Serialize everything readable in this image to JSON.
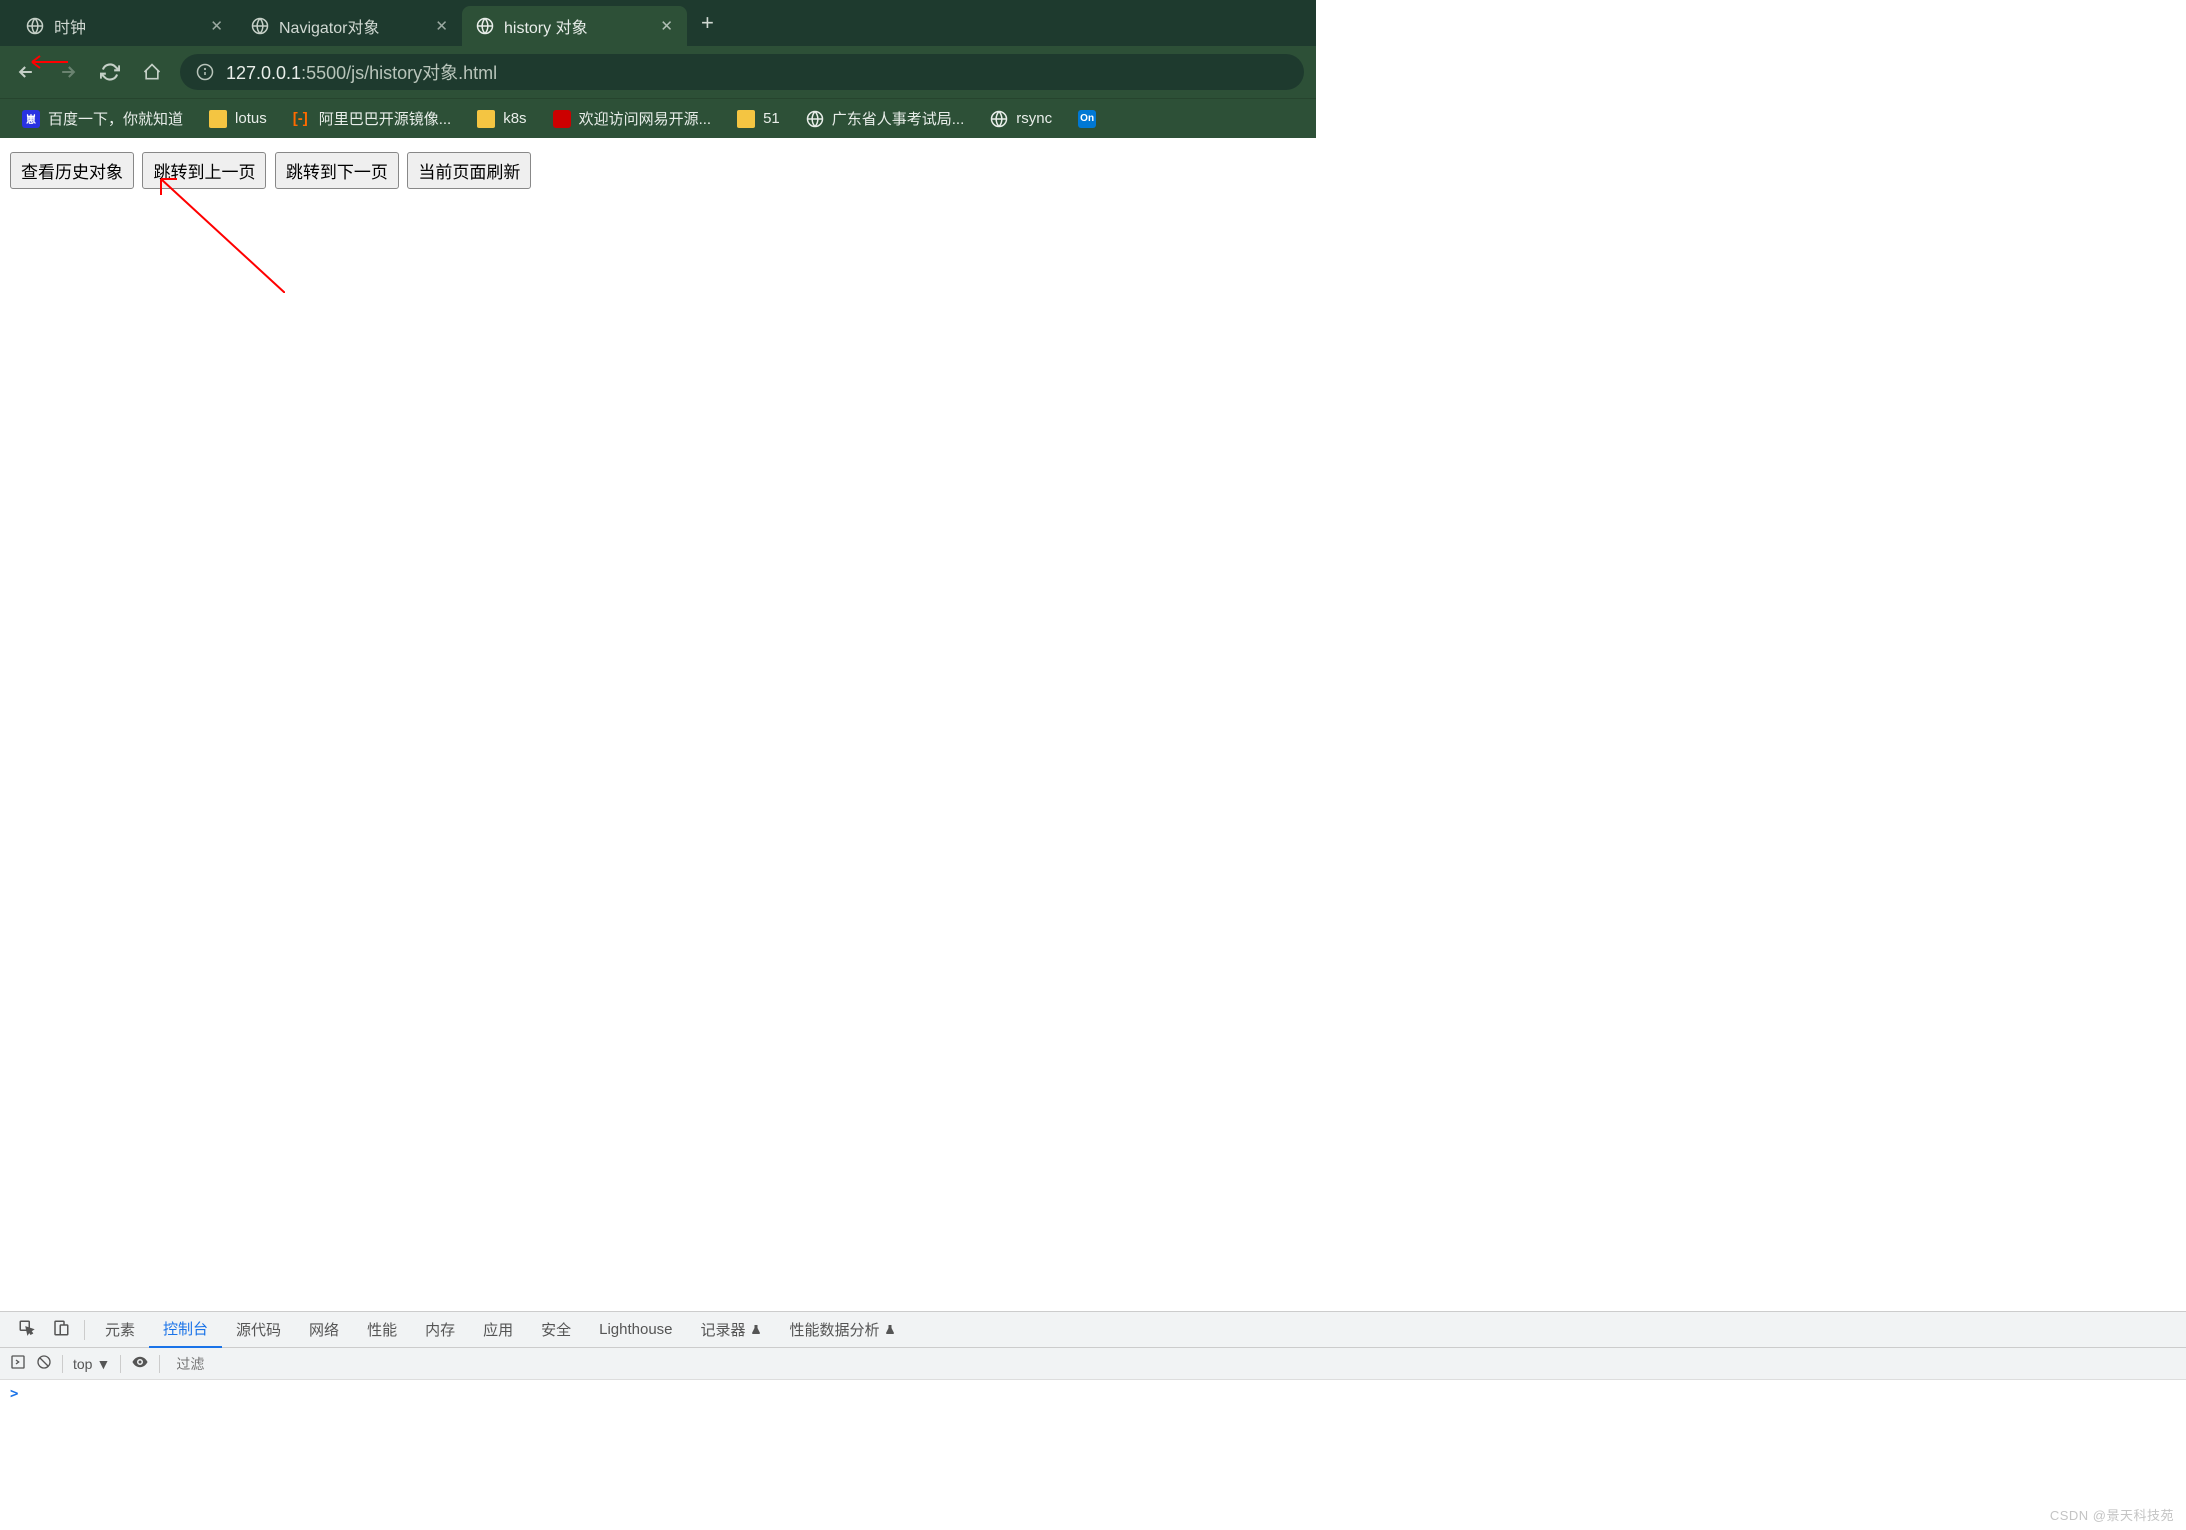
{
  "tabs": [
    {
      "title": "时钟",
      "active": false
    },
    {
      "title": "Navigator对象",
      "active": false
    },
    {
      "title": "history 对象",
      "active": true
    }
  ],
  "url": {
    "prefix": "127.0.0.1",
    "suffix": ":5500/js/history对象.html"
  },
  "bookmarks": [
    {
      "label": "百度一下，你就知道",
      "icon": "baidu"
    },
    {
      "label": "lotus",
      "icon": "folder"
    },
    {
      "label": "阿里巴巴开源镜像...",
      "icon": "alibaba"
    },
    {
      "label": "k8s",
      "icon": "folder"
    },
    {
      "label": "欢迎访问网易开源...",
      "icon": "netease"
    },
    {
      "label": "51",
      "icon": "folder"
    },
    {
      "label": "广东省人事考试局...",
      "icon": "globe"
    },
    {
      "label": "rsync",
      "icon": "globe"
    },
    {
      "label": "",
      "icon": "onedrive"
    }
  ],
  "page": {
    "buttons": [
      "查看历史对象",
      "跳转到上一页",
      "跳转到下一页",
      "当前页面刷新"
    ]
  },
  "devtools": {
    "tabs": [
      "元素",
      "控制台",
      "源代码",
      "网络",
      "性能",
      "内存",
      "应用",
      "安全",
      "Lighthouse",
      "记录器",
      "性能数据分析"
    ],
    "active_tab": "控制台",
    "context": "top",
    "filter_placeholder": "过滤",
    "prompt": ">"
  },
  "watermark": "CSDN @景天科技苑"
}
